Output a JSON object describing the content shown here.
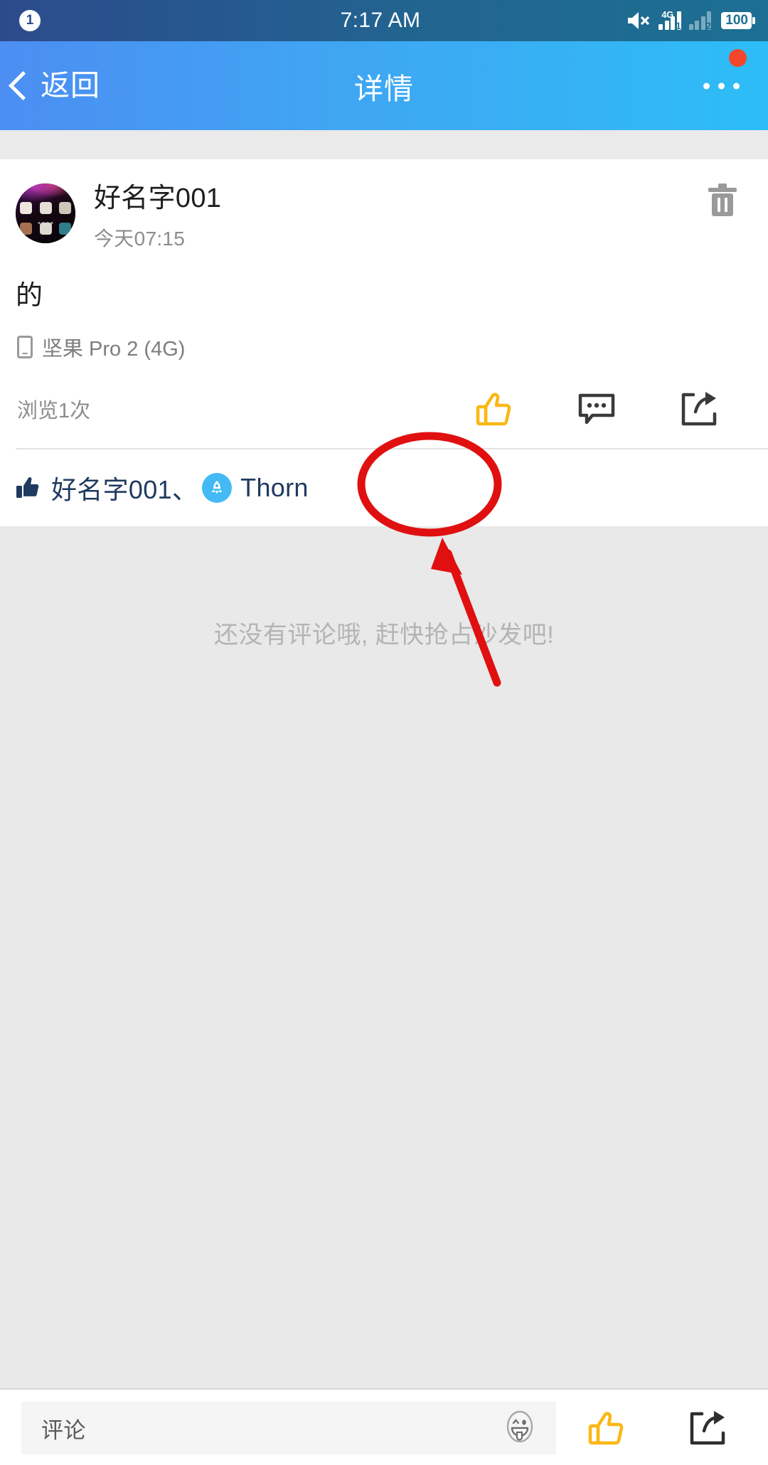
{
  "status_bar": {
    "notification_count": "1",
    "time": "7:17 AM",
    "mute_icon": "volume-mute-icon",
    "sim1_label": "4G",
    "sim1_number": "1",
    "sim2_number": "2",
    "battery_level": "100"
  },
  "nav_bar": {
    "back_label": "返回",
    "title": "详情",
    "more_icon": "more-dots-icon",
    "badge_color": "#f4462a",
    "gradient_start": "#4c8ef2",
    "gradient_end": "#2dbdf6"
  },
  "post": {
    "author": "好名字001",
    "time": "今天07:15",
    "content": "的",
    "device": "坚果 Pro 2 (4G)",
    "views": "浏览1次",
    "delete_icon": "trash-icon",
    "actions": [
      {
        "name": "like-button",
        "icon": "thumbs-up-icon",
        "color": "#fbb713"
      },
      {
        "name": "comment-button",
        "icon": "comment-bubble-icon",
        "color": "#3a3a3a"
      },
      {
        "name": "share-button",
        "icon": "share-icon",
        "color": "#3a3a3a"
      }
    ],
    "likes": {
      "icon": "thumbs-up-filled-icon",
      "names": "好名字001、",
      "second_user": "Thorn",
      "second_user_badge": "rocket-badge-icon",
      "text_color": "#1f3a5f"
    }
  },
  "comments": {
    "empty_message": "还没有评论哦, 赶快抢占沙发吧!"
  },
  "bottom_bar": {
    "input_placeholder": "评论",
    "emoji_icon": "emoji-face-icon",
    "like_icon": "thumbs-up-icon",
    "share_icon": "share-icon",
    "like_color": "#fbb713"
  },
  "annotations": {
    "ellipse": {
      "name": "red-ellipse-highlight",
      "color": "#e01010"
    },
    "arrow": {
      "name": "red-arrow-pointer",
      "color": "#e01010"
    }
  }
}
